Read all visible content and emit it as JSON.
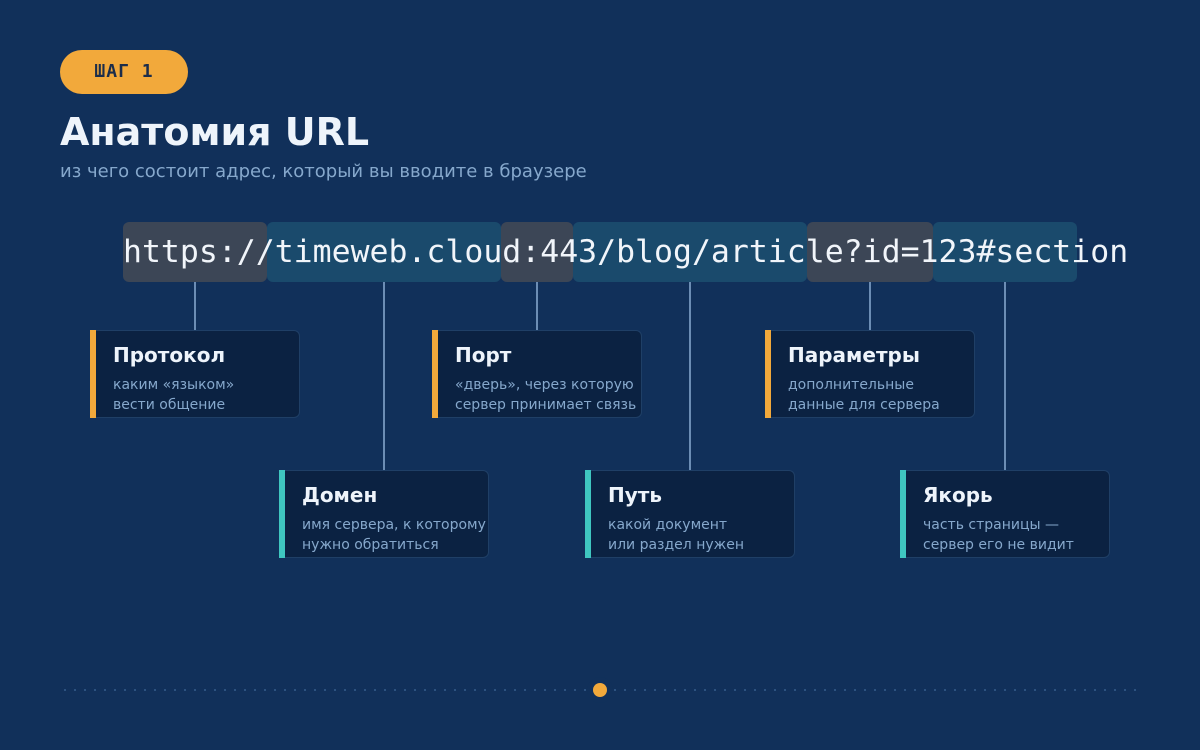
{
  "header": {
    "step_label": "ШАГ 1",
    "title": "Анатомия URL",
    "subtitle": "из чего состоит адрес, который вы вводите в браузере"
  },
  "url": {
    "full": "https://timeweb.cloud:443/blog/article?id=123#section",
    "segments": [
      {
        "text": "https://",
        "part": "protocol"
      },
      {
        "text": "timeweb.cloud",
        "part": "domain"
      },
      {
        "text": ":443",
        "part": "port"
      },
      {
        "text": "/blog/article",
        "part": "path"
      },
      {
        "text": "?id=123",
        "part": "params"
      },
      {
        "text": "#section",
        "part": "anchor"
      }
    ]
  },
  "parts": [
    {
      "title": "Протокол",
      "desc_line1": "каким «языком»",
      "desc_line2": "вести общение"
    },
    {
      "title": "Домен",
      "desc_line1": "имя сервера, к которому",
      "desc_line2": "нужно обратиться"
    },
    {
      "title": "Порт",
      "desc_line1": "«дверь», через которую",
      "desc_line2": "сервер принимает связь"
    },
    {
      "title": "Путь",
      "desc_line1": "какой документ",
      "desc_line2": "или раздел нужен"
    },
    {
      "title": "Параметры",
      "desc_line1": "дополнительные",
      "desc_line2": "данные для сервера"
    },
    {
      "title": "Якорь",
      "desc_line1": "часть страницы —",
      "desc_line2": "сервер его не видит"
    }
  ],
  "colors": {
    "background": "#11305a",
    "accent_orange": "#f2a93b",
    "accent_teal": "#3fc6c0",
    "segment_dark": "#3c4656",
    "segment_blue": "#1a4a6c"
  },
  "pagination": {
    "active_index": 0
  }
}
